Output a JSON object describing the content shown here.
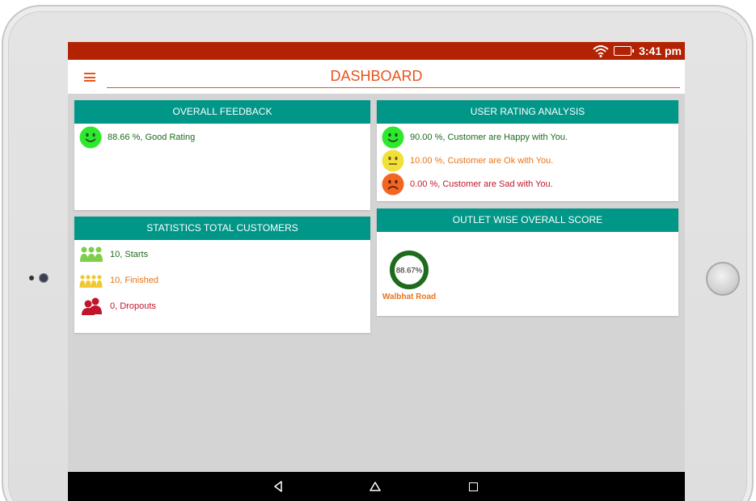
{
  "status_bar": {
    "time": "3:41 pm",
    "icons": [
      "wifi-icon",
      "battery-icon"
    ]
  },
  "app_bar": {
    "title": "DASHBOARD",
    "menu_icon": "hamburger-menu-icon"
  },
  "colors": {
    "status_bar": "#b32303",
    "accent": "#e8541c",
    "card_header": "#009688",
    "happy": "#2ee82e",
    "ok": "#f2e03a",
    "sad": "#f26522",
    "green_text": "#1e6b1e",
    "orange_text": "#e8741c",
    "red_text": "#c0162b"
  },
  "overall_feedback": {
    "header": "OVERALL FEEDBACK",
    "value": "88.66 %",
    "text": ", Good Rating",
    "icon": "happy-face-icon"
  },
  "user_rating_analysis": {
    "header": "USER RATING ANALYSIS",
    "rows": [
      {
        "value": "90.00 %",
        "text": ", Customer are Happy with You.",
        "icon": "happy-face-icon"
      },
      {
        "value": "10.00 %",
        "text": ", Customer are Ok with You.",
        "icon": "neutral-face-icon"
      },
      {
        "value": "0.00 %",
        "text": ", Customer are Sad with You.",
        "icon": "sad-face-icon"
      }
    ]
  },
  "statistics_total_customers": {
    "header": "STATISTICS TOTAL CUSTOMERS",
    "rows": [
      {
        "value": "10",
        "text": ", Starts",
        "icon": "people-group-icon"
      },
      {
        "value": "10",
        "text": ", Finished",
        "icon": "people-group-icon"
      },
      {
        "value": "0",
        "text": ", Dropouts",
        "icon": "people-pair-icon"
      }
    ]
  },
  "outlet_wise_overall_score": {
    "header": "OUTLET WISE OVERALL SCORE",
    "outlets": [
      {
        "score_label": "88.67%",
        "score": 88.67,
        "name": "Walbhat Road"
      }
    ]
  },
  "nav_bar": {
    "icons": [
      "back-icon",
      "home-icon",
      "recent-apps-icon"
    ]
  }
}
